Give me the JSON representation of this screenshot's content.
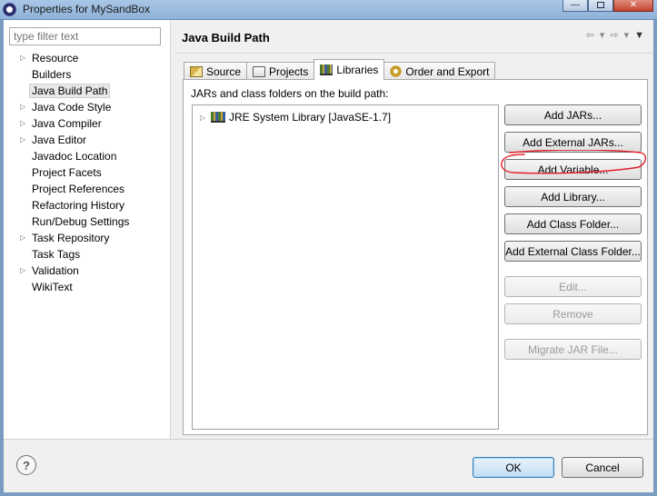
{
  "window": {
    "title": "Properties for MySandBox",
    "controls": [
      "minimize",
      "maximize",
      "close"
    ]
  },
  "filter": {
    "placeholder": "type filter text"
  },
  "sidebar": {
    "items": [
      {
        "label": "Resource",
        "expandable": true
      },
      {
        "label": "Builders",
        "expandable": false
      },
      {
        "label": "Java Build Path",
        "expandable": false,
        "selected": true
      },
      {
        "label": "Java Code Style",
        "expandable": true
      },
      {
        "label": "Java Compiler",
        "expandable": true
      },
      {
        "label": "Java Editor",
        "expandable": true
      },
      {
        "label": "Javadoc Location",
        "expandable": false
      },
      {
        "label": "Project Facets",
        "expandable": false
      },
      {
        "label": "Project References",
        "expandable": false
      },
      {
        "label": "Refactoring History",
        "expandable": false
      },
      {
        "label": "Run/Debug Settings",
        "expandable": false
      },
      {
        "label": "Task Repository",
        "expandable": true
      },
      {
        "label": "Task Tags",
        "expandable": false
      },
      {
        "label": "Validation",
        "expandable": true
      },
      {
        "label": "WikiText",
        "expandable": false
      }
    ]
  },
  "page": {
    "title": "Java Build Path"
  },
  "tabs": [
    {
      "label": "Source",
      "icon": "source-folder-icon"
    },
    {
      "label": "Projects",
      "icon": "projects-icon"
    },
    {
      "label": "Libraries",
      "icon": "libraries-icon",
      "active": true
    },
    {
      "label": "Order and Export",
      "icon": "order-export-icon"
    }
  ],
  "libraries": {
    "label": "JARs and class folders on the build path:",
    "entries": [
      {
        "label": "JRE System Library [JavaSE-1.7]",
        "icon": "library-icon"
      }
    ]
  },
  "buttons": {
    "add_jars": "Add JARs...",
    "add_external_jars": "Add External JARs...",
    "add_variable": "Add Variable...",
    "add_library": "Add Library...",
    "add_class_folder": "Add Class Folder...",
    "add_external_class_folder": "Add External Class Folder...",
    "edit": "Edit...",
    "remove": "Remove",
    "migrate_jar": "Migrate JAR File..."
  },
  "footer": {
    "help": "?",
    "ok": "OK",
    "cancel": "Cancel"
  },
  "colors": {
    "annotation": "#e0202a",
    "selection": "#e8e8e8",
    "default_button_border": "#3c7fb1"
  }
}
